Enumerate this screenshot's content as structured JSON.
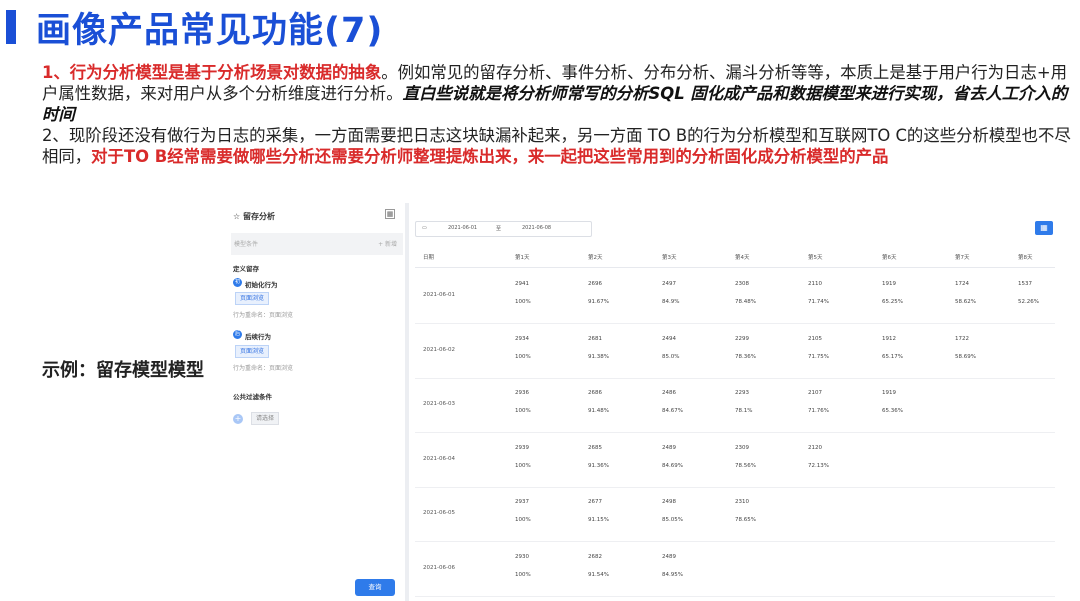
{
  "title": "画像产品常见功能(7)",
  "paragraph1": {
    "red": "1、行为分析模型是基于分析场景对数据的抽象",
    "plain": "。例如常见的留存分析、事件分析、分布分析、漏斗分析等等，本质上是基于用户行为日志+用户属性数据，来对用户从多个分析维度进行分析。",
    "italic": "直白些说就是将分析师常写的分析SQL 固化成产品和数据模型来进行实现，省去人工介入的时间"
  },
  "paragraph2": {
    "plain": "2、现阶段还没有做行为日志的采集，一方面需要把日志这块缺漏补起来，另一方面 TO B的行为分析模型和互联网TO C的这些分析模型也不尽相同，",
    "red": "对于TO B经常需要做哪些分析还需要分析师整理提炼出来，来一起把这些常用到的分析固化成分析模型的产品"
  },
  "example_label": "示例：留存模型模型",
  "left": {
    "title": "☆ 留存分析",
    "model_placeholder": "模型条件",
    "add_label": "+ 新增",
    "define_label": "定义留存",
    "initial_badge": "初",
    "initial_label": "初始化行为",
    "initial_tag": "页面浏览",
    "initial_rename": "行为重命名：页面浏览",
    "follow_badge": "后",
    "follow_label": "后续行为",
    "follow_tag": "页面浏览",
    "follow_rename": "行为重命名：页面浏览",
    "filter_label": "公共过滤条件",
    "filter_tag": "请选择",
    "query_button": "查询"
  },
  "right": {
    "date_from": "2021-06-01",
    "date_sep": "至",
    "date_to": "2021-06-08",
    "headers": [
      "日期",
      "第1天",
      "第2天",
      "第3天",
      "第4天",
      "第5天",
      "第6天",
      "第7天",
      "第8天"
    ],
    "rows": [
      {
        "date": "2021-06-01",
        "counts": [
          "2941",
          "2696",
          "2497",
          "2308",
          "2110",
          "1919",
          "1724",
          "1537"
        ],
        "percents": [
          "100%",
          "91.67%",
          "84.9%",
          "78.48%",
          "71.74%",
          "65.25%",
          "58.62%",
          "52.26%"
        ]
      },
      {
        "date": "2021-06-02",
        "counts": [
          "2934",
          "2681",
          "2494",
          "2299",
          "2105",
          "1912",
          "1722"
        ],
        "percents": [
          "100%",
          "91.38%",
          "85.0%",
          "78.36%",
          "71.75%",
          "65.17%",
          "58.69%"
        ]
      },
      {
        "date": "2021-06-03",
        "counts": [
          "2936",
          "2686",
          "2486",
          "2293",
          "2107",
          "1919"
        ],
        "percents": [
          "100%",
          "91.48%",
          "84.67%",
          "78.1%",
          "71.76%",
          "65.36%"
        ]
      },
      {
        "date": "2021-06-04",
        "counts": [
          "2939",
          "2685",
          "2489",
          "2309",
          "2120"
        ],
        "percents": [
          "100%",
          "91.36%",
          "84.69%",
          "78.56%",
          "72.13%"
        ]
      },
      {
        "date": "2021-06-05",
        "counts": [
          "2937",
          "2677",
          "2498",
          "2310"
        ],
        "percents": [
          "100%",
          "91.15%",
          "85.05%",
          "78.65%"
        ]
      },
      {
        "date": "2021-06-06",
        "counts": [
          "2930",
          "2682",
          "2489"
        ],
        "percents": [
          "100%",
          "91.54%",
          "84.95%"
        ]
      }
    ]
  }
}
